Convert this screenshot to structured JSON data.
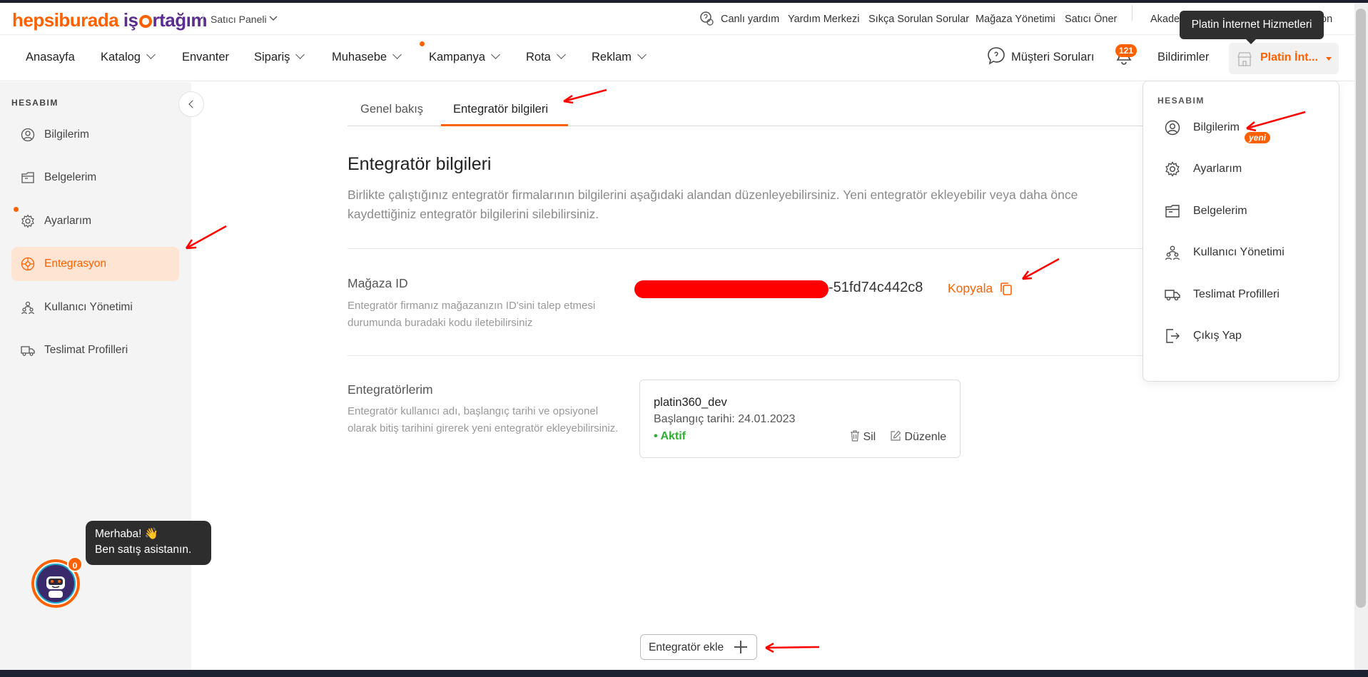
{
  "brand": {
    "part1": "hepsiburada",
    "part2": "iş",
    "part3": "rtağım",
    "panel": "Satıcı Paneli"
  },
  "top_links": [
    "Canlı yardım",
    "Yardım Merkezi",
    "Sıkça Sorulan Sorular",
    "Mağaza Yönetimi",
    "Satıcı Öner",
    "Akade",
    "on"
  ],
  "nav": [
    {
      "label": "Anasayfa",
      "chevron": false
    },
    {
      "label": "Katalog",
      "chevron": true
    },
    {
      "label": "Envanter",
      "chevron": false
    },
    {
      "label": "Sipariş",
      "chevron": true
    },
    {
      "label": "Muhasebe",
      "chevron": true
    },
    {
      "label": "Kampanya",
      "chevron": true
    },
    {
      "label": "Rota",
      "chevron": true
    },
    {
      "label": "Reklam",
      "chevron": true
    }
  ],
  "header_right": {
    "questions": "Müşteri Soruları",
    "notif_count": "121",
    "notifications": "Bildirimler",
    "account_name": "Platin İnt...",
    "tooltip": "Platin İnternet Hizmetleri"
  },
  "sidebar": {
    "title": "HESABIM",
    "items": [
      {
        "label": "Bilgilerim",
        "icon": "user-circle-icon"
      },
      {
        "label": "Belgelerim",
        "icon": "folder-icon"
      },
      {
        "label": "Ayarlarım",
        "icon": "gear-icon"
      },
      {
        "label": "Entegrasyon",
        "icon": "integration-icon",
        "active": true
      },
      {
        "label": "Kullanıcı Yönetimi",
        "icon": "users-icon"
      },
      {
        "label": "Teslimat Profilleri",
        "icon": "truck-icon"
      }
    ]
  },
  "tabs": [
    {
      "label": "Genel bakış"
    },
    {
      "label": "Entegratör bilgileri",
      "active": true
    }
  ],
  "main": {
    "title": "Entegratör bilgileri",
    "description": "Birlikte çalıştığınız entegratör firmalarının bilgilerini aşağıdaki alandan düzenleyebilirsiniz. Yeni entegratör ekleyebilir veya daha önce kaydettiğiniz entegratör bilgilerini silebilirsiniz.",
    "store_id_title": "Mağaza ID",
    "store_id_desc": "Entegratör firmanız mağazanızın ID'sini talep etmesi durumunda buradaki kodu iletebilirsiniz",
    "store_id_value": "-51fd74c442c8",
    "copy_label": "Kopyala",
    "integrators_title": "Entegratörlerim",
    "integrators_desc": "Entegratör kullanıcı adı, başlangıç tarihi ve opsiyonel olarak bitiş tarihini girerek yeni entegratör ekleyebilirsiniz.",
    "integrator": {
      "username": "platin360_dev",
      "start": "Başlangıç tarihi: 24.01.2023",
      "status": "Aktif",
      "delete": "Sil",
      "edit": "Düzenle"
    },
    "add_button": "Entegratör ekle"
  },
  "dropdown": {
    "title": "HESABIM",
    "new_badge": "yeni",
    "items": [
      {
        "label": "Bilgilerim",
        "icon": "user-circle-icon"
      },
      {
        "label": "Ayarlarım",
        "icon": "gear-icon"
      },
      {
        "label": "Belgelerim",
        "icon": "folder-icon"
      },
      {
        "label": "Kullanıcı Yönetimi",
        "icon": "users-icon"
      },
      {
        "label": "Teslimat Profilleri",
        "icon": "truck-icon"
      },
      {
        "label": "Çıkış Yap",
        "icon": "logout-icon"
      }
    ]
  },
  "chat": {
    "line1": "Merhaba! 👋",
    "line2": "Ben satış asistanın.",
    "badge": "0"
  },
  "colors": {
    "accent": "#ff6000",
    "brand_purple": "#5b2d90",
    "active_bg": "#fde4d3",
    "status_green": "#2fae36",
    "annotation_red": "#ff0000"
  }
}
